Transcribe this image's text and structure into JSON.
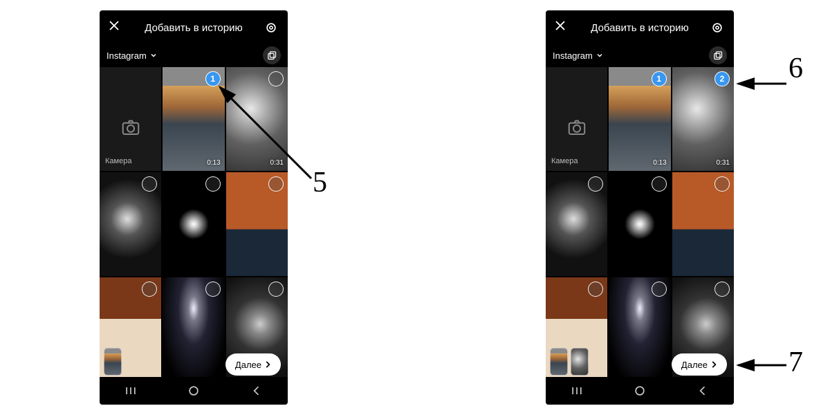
{
  "header": {
    "title": "Добавить в историю",
    "close_icon": "close-icon",
    "settings_icon": "settings-icon"
  },
  "subheader": {
    "album_label": "Instagram",
    "multi_select_icon": "multi-select-icon"
  },
  "camera_tile": {
    "label": "Камера",
    "icon": "camera-icon"
  },
  "next_button": {
    "label": "Далее",
    "icon": "chevron-right-icon"
  },
  "nav": {
    "recents": "recents-icon",
    "home": "home-icon",
    "back": "back-icon"
  },
  "screens": [
    {
      "id": "left",
      "grid": [
        {
          "kind": "camera"
        },
        {
          "kind": "video",
          "art": "thumb-sunset",
          "duration": "0:13",
          "selected": 1
        },
        {
          "kind": "video",
          "art": "thumb-waves",
          "duration": "0:31",
          "selected": null
        },
        {
          "kind": "image",
          "art": "thumb-skull",
          "selected": null
        },
        {
          "kind": "image",
          "art": "thumb-dark",
          "selected": null
        },
        {
          "kind": "image",
          "art": "thumb-orange",
          "selected": null
        },
        {
          "kind": "image",
          "art": "thumb-cat",
          "selected": null
        },
        {
          "kind": "image",
          "art": "thumb-cave",
          "selected": null
        },
        {
          "kind": "image",
          "art": "thumb-rock",
          "selected": null
        }
      ],
      "mini_previews": [
        "thumb-sunset"
      ]
    },
    {
      "id": "right",
      "grid": [
        {
          "kind": "camera"
        },
        {
          "kind": "video",
          "art": "thumb-sunset",
          "duration": "0:13",
          "selected": 1
        },
        {
          "kind": "video",
          "art": "thumb-waves",
          "duration": "0:31",
          "selected": 2
        },
        {
          "kind": "image",
          "art": "thumb-skull",
          "selected": null
        },
        {
          "kind": "image",
          "art": "thumb-dark",
          "selected": null
        },
        {
          "kind": "image",
          "art": "thumb-orange",
          "selected": null
        },
        {
          "kind": "image",
          "art": "thumb-cat",
          "selected": null
        },
        {
          "kind": "image",
          "art": "thumb-cave",
          "selected": null
        },
        {
          "kind": "image",
          "art": "thumb-rock",
          "selected": null
        }
      ],
      "mini_previews": [
        "thumb-sunset",
        "thumb-waves"
      ]
    }
  ],
  "annotations": [
    {
      "label": "5",
      "target": "left-selection-1"
    },
    {
      "label": "6",
      "target": "right-selection-2"
    },
    {
      "label": "7",
      "target": "right-next-button"
    }
  ]
}
